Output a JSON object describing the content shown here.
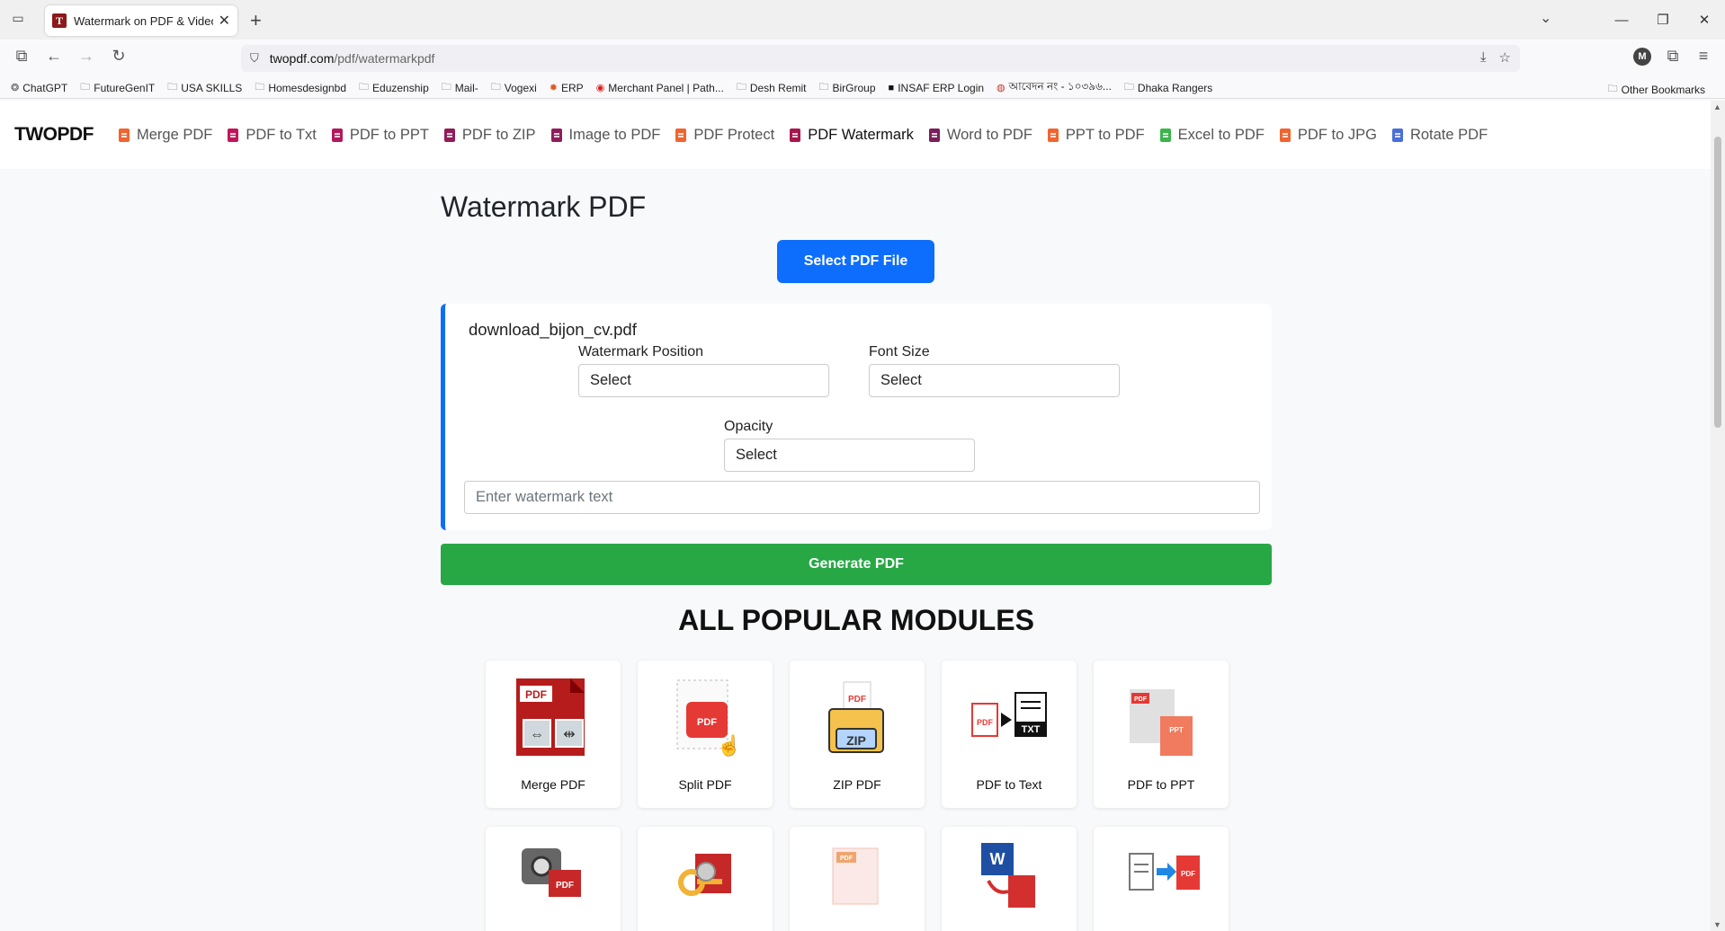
{
  "browser": {
    "tab_title": "Watermark on PDF & Video: Ho",
    "favicon_letter": "T",
    "url_host": "twopdf.com",
    "url_path": "/pdf/watermarkpdf",
    "profile_initial": "M",
    "bookmarks": [
      {
        "label": "ChatGPT",
        "icon": "chatgpt-icon"
      },
      {
        "label": "FutureGenIT",
        "icon": "folder-icon"
      },
      {
        "label": "USA SKILLS",
        "icon": "folder-icon"
      },
      {
        "label": "Homesdesignbd",
        "icon": "folder-icon"
      },
      {
        "label": "Eduzenship",
        "icon": "folder-icon"
      },
      {
        "label": "Mail-",
        "icon": "folder-icon"
      },
      {
        "label": "Vogexi",
        "icon": "folder-icon"
      },
      {
        "label": "ERP",
        "icon": "erp-icon"
      },
      {
        "label": "Merchant Panel | Path...",
        "icon": "pathao-icon"
      },
      {
        "label": "Desh Remit",
        "icon": "folder-icon"
      },
      {
        "label": "BirGroup",
        "icon": "folder-icon"
      },
      {
        "label": "INSAF ERP Login",
        "icon": "insaf-icon"
      },
      {
        "label": "আবেদন নং - ১০৩৯৬...",
        "icon": "gov-icon"
      },
      {
        "label": "Dhaka Rangers",
        "icon": "folder-icon"
      }
    ],
    "other_bookmarks": "Other Bookmarks"
  },
  "site": {
    "brand": "TWOPDF",
    "nav": [
      {
        "label": "Merge PDF",
        "color": "#f0642f"
      },
      {
        "label": "PDF to Txt",
        "color": "#c0175c"
      },
      {
        "label": "PDF to PPT",
        "color": "#b2185e"
      },
      {
        "label": "PDF to ZIP",
        "color": "#8f1d5a"
      },
      {
        "label": "Image to PDF",
        "color": "#8f1d5a"
      },
      {
        "label": "PDF Protect",
        "color": "#f0642f"
      },
      {
        "label": "PDF Watermark",
        "color": "#a8154f"
      },
      {
        "label": "Word to PDF",
        "color": "#7a1e5c"
      },
      {
        "label": "PPT to PDF",
        "color": "#f0642f"
      },
      {
        "label": "Excel to PDF",
        "color": "#3cb54a"
      },
      {
        "label": "PDF to JPG",
        "color": "#f0642f"
      },
      {
        "label": "Rotate PDF",
        "color": "#4a6fd8"
      }
    ]
  },
  "main": {
    "title": "Watermark PDF",
    "select_button": "Select PDF File",
    "file_name": "download_bijon_cv.pdf",
    "position_label": "Watermark Position",
    "position_value": "Select",
    "font_size_label": "Font Size",
    "font_size_value": "Select",
    "opacity_label": "Opacity",
    "opacity_value": "Select",
    "watermark_placeholder": "Enter watermark text",
    "generate_button": "Generate PDF"
  },
  "modules": {
    "title": "ALL POPULAR MODULES",
    "items": [
      {
        "label": "Merge PDF",
        "icon": "merge-pdf-icon"
      },
      {
        "label": "Split PDF",
        "icon": "split-pdf-icon"
      },
      {
        "label": "ZIP PDF",
        "icon": "zip-pdf-icon"
      },
      {
        "label": "PDF to Text",
        "icon": "pdf-to-text-icon"
      },
      {
        "label": "PDF to PPT",
        "icon": "pdf-to-ppt-icon"
      },
      {
        "label": "",
        "icon": "image-to-pdf-icon"
      },
      {
        "label": "",
        "icon": "pdf-protect-icon"
      },
      {
        "label": "",
        "icon": "pdf-watermark-icon"
      },
      {
        "label": "",
        "icon": "word-to-pdf-icon"
      },
      {
        "label": "",
        "icon": "doc-to-pdf-icon"
      }
    ]
  }
}
